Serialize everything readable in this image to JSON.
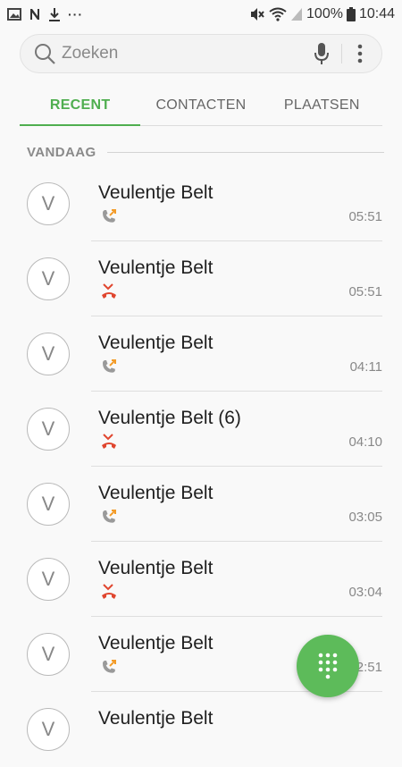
{
  "statusbar": {
    "battery": "100%",
    "time": "10:44"
  },
  "search": {
    "placeholder": "Zoeken"
  },
  "tabs": [
    {
      "label": "RECENT",
      "active": true
    },
    {
      "label": "CONTACTEN",
      "active": false
    },
    {
      "label": "PLAATSEN",
      "active": false
    }
  ],
  "section": {
    "title": "VANDAAG"
  },
  "calls": [
    {
      "initial": "V",
      "name": "Veulentje Belt",
      "type": "outgoing",
      "time": "05:51"
    },
    {
      "initial": "V",
      "name": "Veulentje Belt",
      "type": "missed",
      "time": "05:51"
    },
    {
      "initial": "V",
      "name": "Veulentje Belt",
      "type": "outgoing",
      "time": "04:11"
    },
    {
      "initial": "V",
      "name": "Veulentje Belt (6)",
      "type": "missed",
      "time": "04:10"
    },
    {
      "initial": "V",
      "name": "Veulentje Belt",
      "type": "outgoing",
      "time": "03:05"
    },
    {
      "initial": "V",
      "name": "Veulentje Belt",
      "type": "missed",
      "time": "03:04"
    },
    {
      "initial": "V",
      "name": "Veulentje Belt",
      "type": "outgoing",
      "time": "02:51"
    },
    {
      "initial": "V",
      "name": "Veulentje Belt",
      "type": "missed",
      "time": ""
    }
  ],
  "colors": {
    "accent": "#4fae4f",
    "fab": "#5dbb5a",
    "missed": "#e0462f",
    "outgoing_arrow": "#f39c2a"
  }
}
